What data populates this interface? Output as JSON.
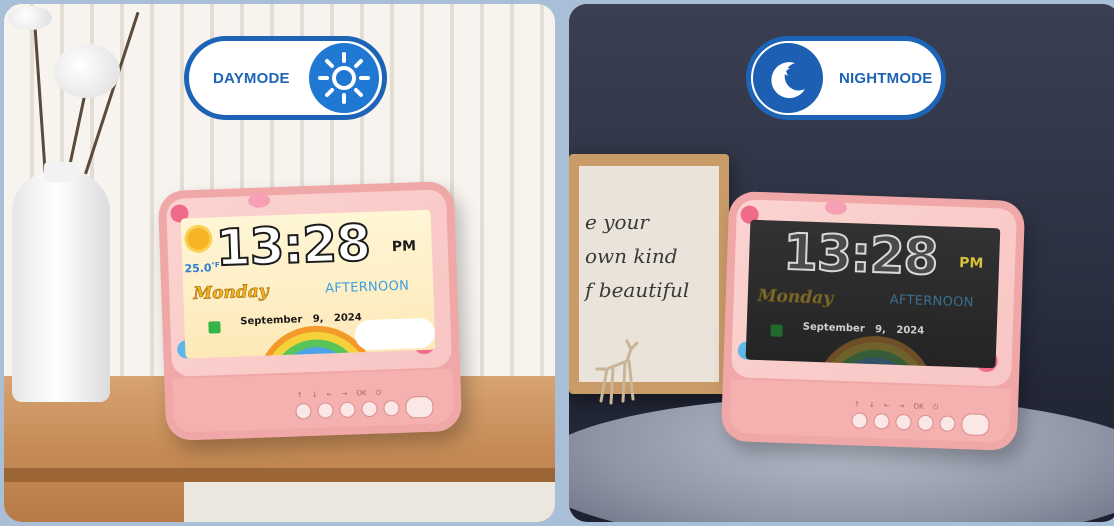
{
  "day_panel": {
    "badge_label": "DAYMODE",
    "clock": {
      "time": "13:28",
      "ampm": "PM",
      "temperature": "25.0",
      "temperature_unit": "°F",
      "weekday": "Monday",
      "period": "AFTERNOON",
      "date": "September   9,   2024"
    }
  },
  "night_panel": {
    "badge_label": "NIGHTMODE",
    "clock": {
      "time": "13:28",
      "ampm": "PM",
      "weekday": "Monday",
      "period": "AFTERNOON",
      "date": "September   9,   2024"
    },
    "frame_text_lines": [
      "e your",
      "own kind",
      "f beautiful"
    ]
  },
  "device_button_labels": [
    "↑",
    "↓",
    "←",
    "→",
    "OK",
    "⏻"
  ],
  "colors": {
    "badge_blue": "#1d64b6",
    "device_pink": "#f0a7a7",
    "day_screen": "#fdf3c9",
    "night_screen": "#2a2a2a"
  },
  "icons": {
    "day": "sun-icon",
    "night": "moon-stars-icon"
  }
}
